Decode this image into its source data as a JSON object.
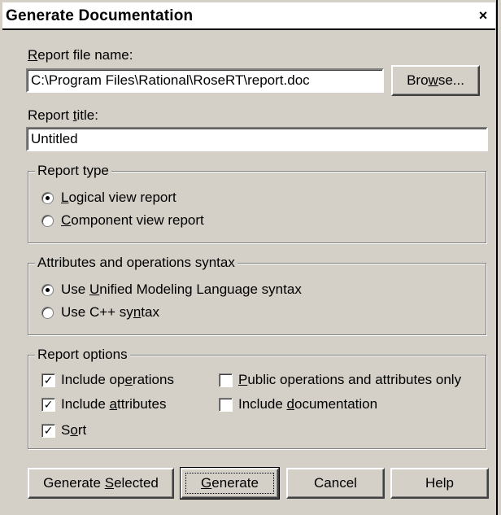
{
  "window": {
    "title": "Generate Documentation",
    "close_label": "×"
  },
  "report_file": {
    "label_pre": "",
    "label_key": "R",
    "label_post": "eport file name:",
    "value": "C:\\Program Files\\Rational\\RoseRT\\report.doc",
    "browse_pre": "Bro",
    "browse_key": "w",
    "browse_post": "se..."
  },
  "report_title": {
    "label_pre": "Report ",
    "label_key": "t",
    "label_post": "itle:",
    "value": "Untitled"
  },
  "report_type": {
    "title": "Report type",
    "options": [
      {
        "pre": "",
        "key": "L",
        "post": "ogical view report",
        "selected": true
      },
      {
        "pre": "",
        "key": "C",
        "post": "omponent view report",
        "selected": false
      }
    ]
  },
  "syntax": {
    "title": "Attributes and operations syntax",
    "options": [
      {
        "pre": "Use ",
        "key": "U",
        "post": "nified Modeling Language syntax",
        "selected": true
      },
      {
        "pre": "Use C++ sy",
        "key": "n",
        "post": "tax",
        "selected": false
      }
    ]
  },
  "report_options": {
    "title": "Report options",
    "left": [
      {
        "pre": "Include op",
        "key": "e",
        "post": "rations",
        "checked": true,
        "mark": "✓"
      },
      {
        "pre": "Include ",
        "key": "a",
        "post": "ttributes",
        "checked": true,
        "mark": "✓"
      },
      {
        "pre": "S",
        "key": "o",
        "post": "rt",
        "checked": true,
        "mark": "✓"
      }
    ],
    "right": [
      {
        "pre": "",
        "key": "P",
        "post": "ublic operations and attributes only",
        "checked": false,
        "mark": ""
      },
      {
        "pre": "Include ",
        "key": "d",
        "post": "ocumentation",
        "checked": false,
        "mark": ""
      }
    ]
  },
  "buttons": {
    "gen_selected_pre": "Generate ",
    "gen_selected_key": "S",
    "gen_selected_post": "elected",
    "generate_key": "G",
    "generate_post": "enerate",
    "cancel": "Cancel",
    "help": "Help"
  }
}
